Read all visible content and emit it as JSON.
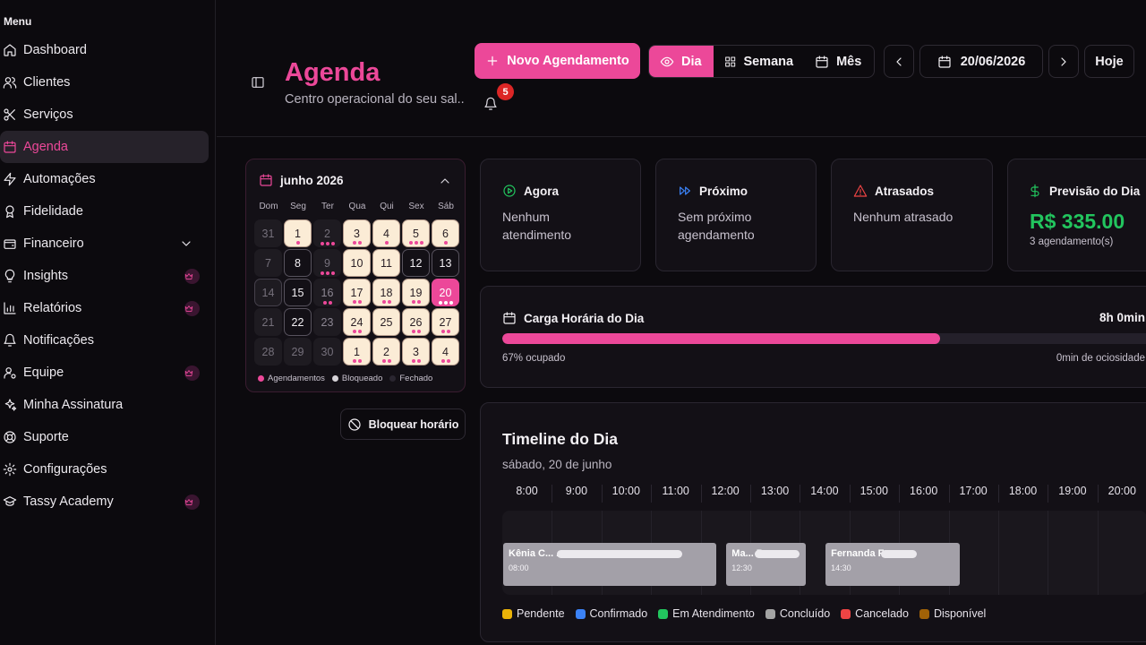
{
  "sidebar": {
    "menu_title": "Menu",
    "items": [
      {
        "label": "Dashboard"
      },
      {
        "label": "Clientes"
      },
      {
        "label": "Serviços"
      },
      {
        "label": "Agenda"
      },
      {
        "label": "Automações"
      },
      {
        "label": "Fidelidade"
      },
      {
        "label": "Financeiro"
      },
      {
        "label": "Insights"
      },
      {
        "label": "Relatórios"
      },
      {
        "label": "Notificações"
      },
      {
        "label": "Equipe"
      },
      {
        "label": "Minha Assinatura"
      },
      {
        "label": "Suporte"
      },
      {
        "label": "Configurações"
      },
      {
        "label": "Tassy Academy"
      }
    ]
  },
  "header": {
    "title": "Agenda",
    "subtitle": "Centro operacional do seu sal...",
    "notification_count": "5",
    "new_button": "Novo Agendamento",
    "views": {
      "day": "Dia",
      "week": "Semana",
      "month": "Mês"
    },
    "date": "20/06/2026",
    "today_button": "Hoje"
  },
  "calendar": {
    "month_label": "junho 2026",
    "weekdays": [
      "Dom",
      "Seg",
      "Ter",
      "Qua",
      "Qui",
      "Sex",
      "Sáb"
    ],
    "days": [
      "31",
      "1",
      "2",
      "3",
      "4",
      "5",
      "6",
      "7",
      "8",
      "9",
      "10",
      "11",
      "12",
      "13",
      "14",
      "15",
      "16",
      "17",
      "18",
      "19",
      "20",
      "21",
      "22",
      "23",
      "24",
      "25",
      "26",
      "27",
      "28",
      "29",
      "30",
      "1",
      "2",
      "3",
      "4"
    ],
    "legend": {
      "appointments": "Agendamentos",
      "blocked": "Bloqueado",
      "closed": "Fechado"
    }
  },
  "block_button": "Bloquear horário",
  "stats": {
    "now": {
      "title": "Agora",
      "text": "Nenhum atendimento"
    },
    "next": {
      "title": "Próximo",
      "text": "Sem próximo agendamento"
    },
    "late": {
      "title": "Atrasados",
      "text": "Nenhum atrasado"
    },
    "forecast": {
      "title": "Previsão do Dia",
      "value": "R$ 335.00",
      "sub": "3 agendamento(s)"
    }
  },
  "workload": {
    "title": "Carga Horária do Dia",
    "total": "8h 0min",
    "occupied_label": "67% ocupado",
    "occupied_fraction": 0.67,
    "idle_label": "0min de ociosidade"
  },
  "timeline": {
    "title": "Timeline do Dia",
    "date_label": "sábado, 20 de junho",
    "hours": [
      "8:00",
      "9:00",
      "10:00",
      "11:00",
      "12:00",
      "13:00",
      "14:00",
      "15:00",
      "16:00",
      "17:00",
      "18:00",
      "19:00",
      "20:00"
    ],
    "appointments": [
      {
        "name": "Kênia C... ...",
        "time": "08:00"
      },
      {
        "name": "Ma... B...",
        "time": "12:30"
      },
      {
        "name": "Fernanda F...",
        "time": "14:30"
      }
    ],
    "legend": [
      {
        "label": "Pendente",
        "color": "#eab308"
      },
      {
        "label": "Confirmado",
        "color": "#3b82f6"
      },
      {
        "label": "Em Atendimento",
        "color": "#22c55e"
      },
      {
        "label": "Concluído",
        "color": "#a3a3a3"
      },
      {
        "label": "Cancelado",
        "color": "#ef4444"
      },
      {
        "label": "Disponível",
        "color": "#a16207"
      }
    ]
  },
  "colors": {
    "accent": "#ec4899",
    "money": "#22c55e",
    "alert": "#ef4444"
  }
}
